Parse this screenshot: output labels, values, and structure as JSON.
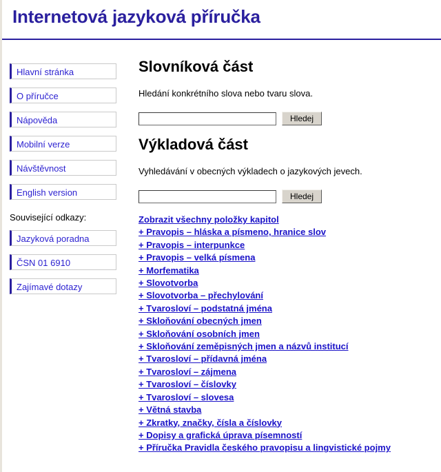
{
  "header": {
    "site_title": "Internetová jazyková příručka",
    "rule_color": "#2a1f9e"
  },
  "sidebar": {
    "nav_items": [
      {
        "label": "Hlavní stránka"
      },
      {
        "label": "O příručce"
      },
      {
        "label": "Nápověda"
      },
      {
        "label": "Mobilní verze"
      },
      {
        "label": "Návštěvnost"
      },
      {
        "label": "English version"
      }
    ],
    "related_label": "Související odkazy:",
    "related_items": [
      {
        "label": "Jazyková poradna"
      },
      {
        "label": "ČSN 01 6910"
      },
      {
        "label": "Zajímavé dotazy"
      }
    ]
  },
  "main": {
    "dictionary": {
      "heading": "Slovníková část",
      "description": "Hledání konkrétního slova nebo tvaru slova.",
      "input_value": "",
      "input_placeholder": "",
      "button_label": "Hledej"
    },
    "explanatory": {
      "heading": "Výkladová část",
      "description": "Vyhledávání v obecných výkladech o jazykových jevech.",
      "input_value": "",
      "input_placeholder": "",
      "button_label": "Hledej"
    },
    "chapter_links": [
      {
        "label": "Zobrazit všechny položky kapitol"
      },
      {
        "label": "+ Pravopis – hláska a písmeno, hranice slov"
      },
      {
        "label": "+ Pravopis – interpunkce"
      },
      {
        "label": "+ Pravopis – velká písmena"
      },
      {
        "label": "+ Morfematika"
      },
      {
        "label": "+ Slovotvorba"
      },
      {
        "label": "+ Slovotvorba – přechylování"
      },
      {
        "label": "+ Tvarosloví – podstatná jména"
      },
      {
        "label": "+ Skloňování obecných jmen"
      },
      {
        "label": "+ Skloňování osobních jmen"
      },
      {
        "label": "+ Skloňování zeměpisných jmen a názvů institucí"
      },
      {
        "label": "+ Tvarosloví – přídavná jména"
      },
      {
        "label": "+ Tvarosloví – zájmena"
      },
      {
        "label": "+ Tvarosloví – číslovky"
      },
      {
        "label": "+ Tvarosloví – slovesa"
      },
      {
        "label": "+ Větná stavba"
      },
      {
        "label": "+ Zkratky, značky, čísla a číslovky"
      },
      {
        "label": "+ Dopisy a grafická úprava písemností"
      },
      {
        "label": "+ Příručka Pravidla českého pravopisu a lingvistické pojmy"
      }
    ]
  },
  "colors": {
    "brand_navy": "#2a1f9e",
    "link_blue": "#1a12c8",
    "nav_link_blue": "#2a1fd0",
    "button_face": "#d8d4cc",
    "nav_border": "#c9c9c9",
    "page_edge": "#e8e4dc"
  }
}
